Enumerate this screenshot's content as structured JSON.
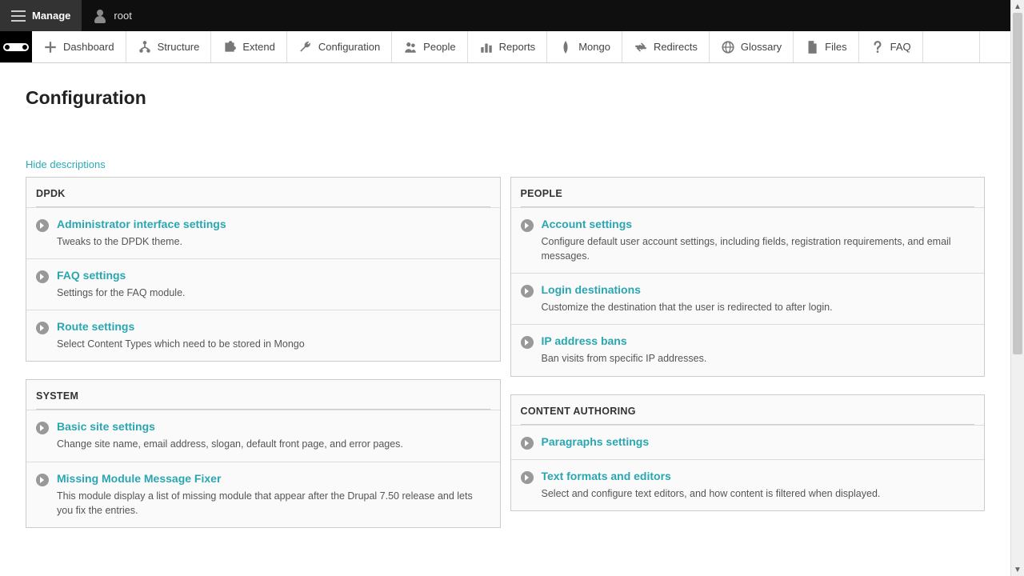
{
  "toolbar": {
    "manage_label": "Manage",
    "user_label": "root"
  },
  "admin_menu": {
    "items": [
      {
        "label": "Dashboard",
        "icon": "plus"
      },
      {
        "label": "Structure",
        "icon": "tree"
      },
      {
        "label": "Extend",
        "icon": "puzzle"
      },
      {
        "label": "Configuration",
        "icon": "wrench"
      },
      {
        "label": "People",
        "icon": "people"
      },
      {
        "label": "Reports",
        "icon": "bars"
      },
      {
        "label": "Mongo",
        "icon": "leaf"
      },
      {
        "label": "Redirects",
        "icon": "redirect"
      },
      {
        "label": "Glossary",
        "icon": "globe"
      },
      {
        "label": "Files",
        "icon": "file"
      },
      {
        "label": "FAQ",
        "icon": "question"
      }
    ]
  },
  "page_title": "Configuration",
  "hide_descriptions_label": "Hide descriptions",
  "left_panels": [
    {
      "title": "DPDK",
      "entries": [
        {
          "title": "Administrator interface settings",
          "desc": "Tweaks to the DPDK theme."
        },
        {
          "title": "FAQ settings",
          "desc": "Settings for the FAQ module."
        },
        {
          "title": "Route settings",
          "desc": "Select Content Types which need to be stored in Mongo"
        }
      ]
    },
    {
      "title": "SYSTEM",
      "entries": [
        {
          "title": "Basic site settings",
          "desc": "Change site name, email address, slogan, default front page, and error pages."
        },
        {
          "title": "Missing Module Message Fixer",
          "desc": "This module display a list of missing module that appear after the Drupal 7.50 release and lets you fix the entries."
        }
      ]
    }
  ],
  "right_panels": [
    {
      "title": "PEOPLE",
      "entries": [
        {
          "title": "Account settings",
          "desc": "Configure default user account settings, including fields, registration requirements, and email messages."
        },
        {
          "title": "Login destinations",
          "desc": "Customize the destination that the user is redirected to after login."
        },
        {
          "title": "IP address bans",
          "desc": "Ban visits from specific IP addresses."
        }
      ]
    },
    {
      "title": "CONTENT AUTHORING",
      "entries": [
        {
          "title": "Paragraphs settings",
          "desc": ""
        },
        {
          "title": "Text formats and editors",
          "desc": "Select and configure text editors, and how content is filtered when displayed."
        }
      ]
    }
  ]
}
